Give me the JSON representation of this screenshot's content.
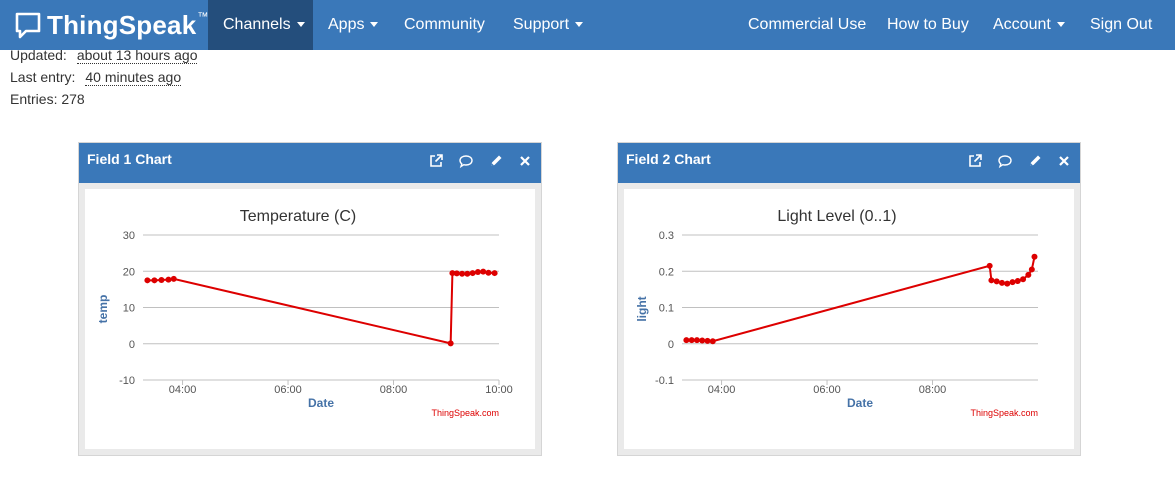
{
  "navbar": {
    "brand": "ThingSpeak",
    "brand_tm": "™",
    "items": [
      {
        "label": "Channels",
        "dropdown": true
      },
      {
        "label": "Apps",
        "dropdown": true
      },
      {
        "label": "Community",
        "dropdown": false
      },
      {
        "label": "Support",
        "dropdown": true
      },
      {
        "label": "Commercial Use",
        "dropdown": false
      },
      {
        "label": "How to Buy",
        "dropdown": false
      },
      {
        "label": "Account",
        "dropdown": true
      },
      {
        "label": "Sign Out",
        "dropdown": false
      }
    ]
  },
  "channel_info": {
    "updated_label": "Updated:",
    "updated_value": "about 13 hours ago",
    "last_entry_label": "Last entry:",
    "last_entry_value": "40 minutes ago",
    "entries": "Entries: 278"
  },
  "panels": [
    {
      "title": "Field 1 Chart",
      "icons": [
        "external-link-icon",
        "comment-icon",
        "pencil-icon",
        "close-icon"
      ]
    },
    {
      "title": "Field 2 Chart",
      "icons": [
        "external-link-icon",
        "comment-icon",
        "pencil-icon",
        "close-icon"
      ]
    }
  ],
  "colors": {
    "navbar": "#3a78b9",
    "active_nav": "#244e7c",
    "series": "#dd0000",
    "axis_label": "#4572a7"
  },
  "chart_data": [
    {
      "type": "line",
      "title": "Temperature (C)",
      "xlabel": "Date",
      "ylabel": "temp",
      "credit": "ThingSpeak.com",
      "ylim": [
        -10,
        30
      ],
      "yticks": [
        "30",
        "20",
        "10",
        "0",
        "-10"
      ],
      "xlim": [
        "03:15",
        "10:00"
      ],
      "xticks": [
        "04:00",
        "06:00",
        "08:00",
        "10:00"
      ],
      "series": [
        {
          "color": "#dd0000",
          "points": [
            [
              "03:20",
              17.5
            ],
            [
              "03:28",
              17.5
            ],
            [
              "03:36",
              17.6
            ],
            [
              "03:44",
              17.7
            ],
            [
              "03:50",
              17.9
            ],
            [
              "09:05",
              0.1
            ],
            [
              "09:07",
              19.5
            ],
            [
              "09:12",
              19.4
            ],
            [
              "09:18",
              19.3
            ],
            [
              "09:24",
              19.3
            ],
            [
              "09:30",
              19.5
            ],
            [
              "09:36",
              19.8
            ],
            [
              "09:42",
              19.9
            ],
            [
              "09:48",
              19.6
            ],
            [
              "09:55",
              19.5
            ]
          ]
        }
      ]
    },
    {
      "type": "line",
      "title": "Light Level (0..1)",
      "xlabel": "Date",
      "ylabel": "light",
      "credit": "ThingSpeak.com",
      "ylim": [
        -0.1,
        0.3
      ],
      "yticks": [
        "0.3",
        "0.2",
        "0.1",
        "0",
        "-0.1"
      ],
      "xlim": [
        "03:15",
        "10:00"
      ],
      "xticks": [
        "04:00",
        "06:00",
        "08:00"
      ],
      "series": [
        {
          "color": "#dd0000",
          "points": [
            [
              "03:20",
              0.01
            ],
            [
              "03:26",
              0.01
            ],
            [
              "03:32",
              0.01
            ],
            [
              "03:38",
              0.009
            ],
            [
              "03:44",
              0.008
            ],
            [
              "03:50",
              0.007
            ],
            [
              "09:05",
              0.215
            ],
            [
              "09:07",
              0.175
            ],
            [
              "09:13",
              0.172
            ],
            [
              "09:19",
              0.168
            ],
            [
              "09:25",
              0.166
            ],
            [
              "09:31",
              0.17
            ],
            [
              "09:37",
              0.173
            ],
            [
              "09:43",
              0.178
            ],
            [
              "09:49",
              0.19
            ],
            [
              "09:53",
              0.205
            ],
            [
              "09:56",
              0.24
            ]
          ]
        }
      ]
    }
  ]
}
